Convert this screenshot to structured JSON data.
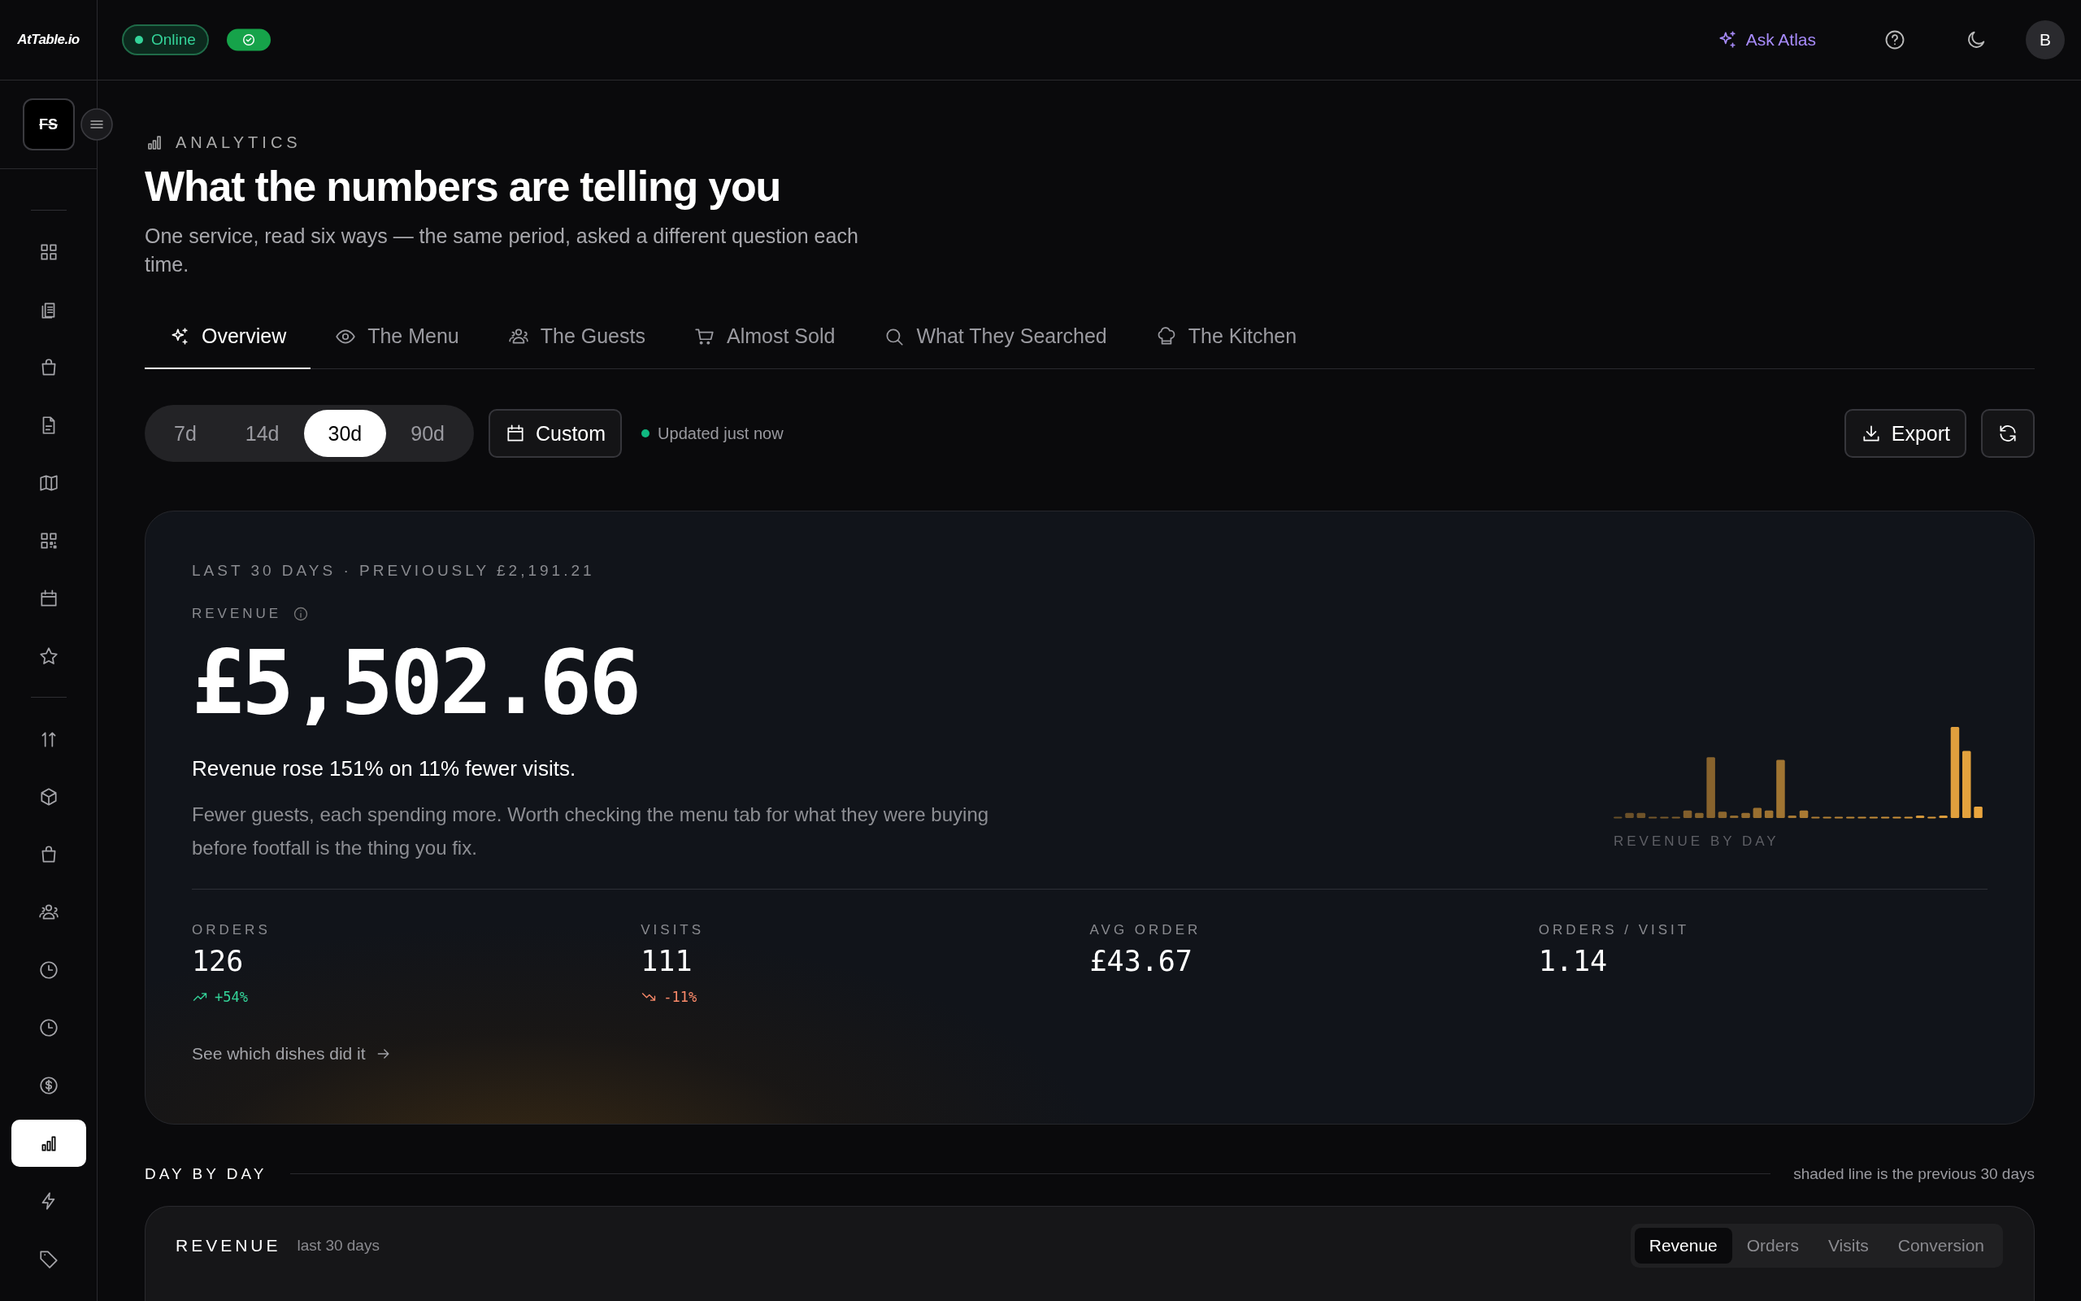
{
  "brand": "AtTable.io",
  "status": {
    "label": "Online",
    "online": true
  },
  "topbar": {
    "assistant": "Ask Atlas",
    "avatar": "B"
  },
  "workspace_logo": "FS",
  "sidebar": {
    "groups": [
      [
        {
          "selected": false
        },
        {
          "selected": false
        },
        {
          "selected": false
        },
        {
          "selected": false
        },
        {
          "selected": false
        },
        {
          "selected": false
        },
        {
          "selected": false
        },
        {
          "selected": false
        }
      ],
      [
        {
          "selected": false
        },
        {
          "selected": false
        },
        {
          "selected": false
        },
        {
          "selected": false
        },
        {
          "selected": false
        },
        {
          "selected": false
        },
        {
          "selected": false
        },
        {
          "selected": true
        },
        {
          "selected": false
        },
        {
          "selected": false
        }
      ]
    ]
  },
  "header": {
    "eyebrow": "ANALYTICS",
    "title": "What the numbers are telling you",
    "subtitle": "One service, read six ways — the same period, asked a different question each time."
  },
  "tabs": [
    {
      "label": "Overview",
      "selected": true
    },
    {
      "label": "The Menu",
      "selected": false
    },
    {
      "label": "The Guests",
      "selected": false
    },
    {
      "label": "Almost Sold",
      "selected": false
    },
    {
      "label": "What They Searched",
      "selected": false
    },
    {
      "label": "The Kitchen",
      "selected": false
    }
  ],
  "periods": [
    {
      "label": "7d",
      "selected": false
    },
    {
      "label": "14d",
      "selected": false
    },
    {
      "label": "30d",
      "selected": true
    },
    {
      "label": "90d",
      "selected": false
    }
  ],
  "custom_button": "Custom",
  "updated": "Updated just now",
  "actions": {
    "export": "Export"
  },
  "hero": {
    "caption": "LAST 30 DAYS · PREVIOUSLY £2,191.21",
    "metric_label": "REVENUE",
    "value": "£5,502.66",
    "headline": "Revenue rose 151% on 11% fewer visits.",
    "body": "Fewer guests, each spending more. Worth checking the menu tab for what they were buying before footfall is the thing you fix.",
    "sparkline_label": "REVENUE BY DAY",
    "stats": [
      {
        "label": "ORDERS",
        "value": "126",
        "delta": "+54%",
        "kind": "up"
      },
      {
        "label": "VISITS",
        "value": "111",
        "delta": "-11%",
        "kind": "down"
      },
      {
        "label": "AVG ORDER",
        "value": "£43.67"
      },
      {
        "label": "ORDERS / VISIT",
        "value": "1.14"
      }
    ],
    "link": "See which dishes did it"
  },
  "section": {
    "title": "DAY BY DAY",
    "note": "shaded line is the previous 30 days"
  },
  "chart_card": {
    "title": "REVENUE",
    "subtitle": "last 30 days",
    "metrics": [
      {
        "label": "Revenue",
        "selected": true
      },
      {
        "label": "Orders",
        "selected": false
      },
      {
        "label": "Visits",
        "selected": false
      },
      {
        "label": "Conversion",
        "selected": false
      }
    ]
  }
}
